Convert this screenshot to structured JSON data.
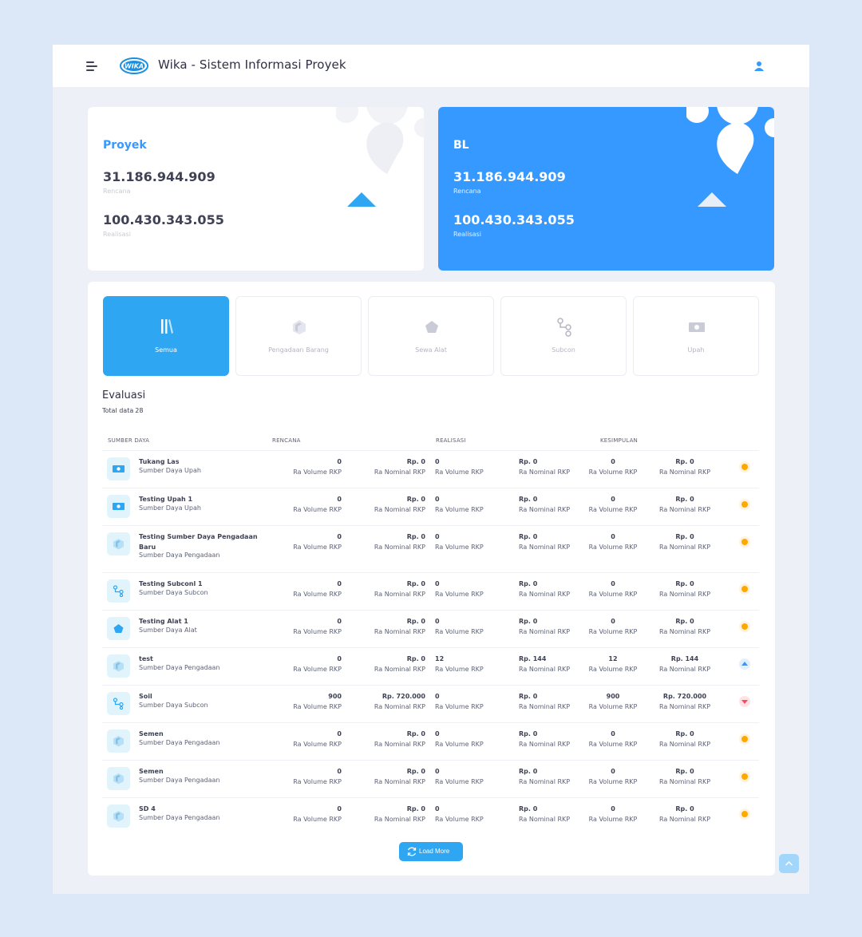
{
  "header": {
    "title": "Wika - Sistem Informasi Proyek",
    "logo_text": "WIKA"
  },
  "cards": {
    "proyek": {
      "title": "Proyek",
      "rencana_value": "31.186.944.909",
      "rencana_label": "Rencana",
      "realisasi_value": "100.430.343.055",
      "realisasi_label": "Realisasi"
    },
    "bl": {
      "title": "BL",
      "rencana_value": "31.186.944.909",
      "rencana_label": "Rencana",
      "realisasi_value": "100.430.343.055",
      "realisasi_label": "Realisasi"
    }
  },
  "tabs": [
    {
      "label": "Semua",
      "icon": "library-icon",
      "active": true
    },
    {
      "label": "Pengadaan Barang",
      "icon": "box-icon",
      "active": false
    },
    {
      "label": "Sewa Alat",
      "icon": "pentagon-icon",
      "active": false
    },
    {
      "label": "Subcon",
      "icon": "subcon-icon",
      "active": false
    },
    {
      "label": "Upah",
      "icon": "money-icon",
      "active": false
    }
  ],
  "evaluasi": {
    "title": "Evaluasi",
    "total_label": "Total data",
    "total": "28"
  },
  "table": {
    "headers": [
      "SUMBER DAYA",
      "RENCANA",
      "REALISASI",
      "KESIMPULAN"
    ],
    "volume_label": "Ra Volume RKP",
    "nominal_label": "Ra Nominal RKP",
    "rows": [
      {
        "name": "Tukang Las",
        "type": "Sumber Daya Upah",
        "icon": "money-icon",
        "rencana_vol": "0",
        "rencana_nom": "Rp. 0",
        "realisasi_vol": "0",
        "realisasi_nom": "Rp. 0",
        "kesimpulan_vol": "0",
        "kesimpulan_nom": "Rp. 0",
        "status": "orange"
      },
      {
        "name": "Testing Upah 1",
        "type": "Sumber Daya Upah",
        "icon": "money-icon",
        "rencana_vol": "0",
        "rencana_nom": "Rp. 0",
        "realisasi_vol": "0",
        "realisasi_nom": "Rp. 0",
        "kesimpulan_vol": "0",
        "kesimpulan_nom": "Rp. 0",
        "status": "orange"
      },
      {
        "name": "Testing Sumber Daya Pengadaan Baru",
        "type": "Sumber Daya Pengadaan",
        "icon": "box-icon",
        "rencana_vol": "0",
        "rencana_nom": "Rp. 0",
        "realisasi_vol": "0",
        "realisasi_nom": "Rp. 0",
        "kesimpulan_vol": "0",
        "kesimpulan_nom": "Rp. 0",
        "status": "orange"
      },
      {
        "name": "Testing Subconl 1",
        "type": "Sumber Daya Subcon",
        "icon": "subcon-icon",
        "rencana_vol": "0",
        "rencana_nom": "Rp. 0",
        "realisasi_vol": "0",
        "realisasi_nom": "Rp. 0",
        "kesimpulan_vol": "0",
        "kesimpulan_nom": "Rp. 0",
        "status": "orange"
      },
      {
        "name": "Testing Alat 1",
        "type": "Sumber Daya Alat",
        "icon": "pentagon-icon",
        "rencana_vol": "0",
        "rencana_nom": "Rp. 0",
        "realisasi_vol": "0",
        "realisasi_nom": "Rp. 0",
        "kesimpulan_vol": "0",
        "kesimpulan_nom": "Rp. 0",
        "status": "orange"
      },
      {
        "name": "test",
        "type": "Sumber Daya Pengadaan",
        "icon": "box-icon",
        "rencana_vol": "0",
        "rencana_nom": "Rp. 0",
        "realisasi_vol": "12",
        "realisasi_nom": "Rp. 144",
        "kesimpulan_vol": "12",
        "kesimpulan_nom": "Rp. 144",
        "status": "up"
      },
      {
        "name": "Soil",
        "type": "Sumber Daya Subcon",
        "icon": "subcon-icon",
        "rencana_vol": "900",
        "rencana_nom": "Rp. 720.000",
        "realisasi_vol": "0",
        "realisasi_nom": "Rp. 0",
        "kesimpulan_vol": "900",
        "kesimpulan_nom": "Rp. 720.000",
        "status": "down"
      },
      {
        "name": "Semen",
        "type": "Sumber Daya Pengadaan",
        "icon": "box-icon",
        "rencana_vol": "0",
        "rencana_nom": "Rp. 0",
        "realisasi_vol": "0",
        "realisasi_nom": "Rp. 0",
        "kesimpulan_vol": "0",
        "kesimpulan_nom": "Rp. 0",
        "status": "orange"
      },
      {
        "name": "Semen",
        "type": "Sumber Daya Pengadaan",
        "icon": "box-icon",
        "rencana_vol": "0",
        "rencana_nom": "Rp. 0",
        "realisasi_vol": "0",
        "realisasi_nom": "Rp. 0",
        "kesimpulan_vol": "0",
        "kesimpulan_nom": "Rp. 0",
        "status": "orange"
      },
      {
        "name": "SD 4",
        "type": "Sumber Daya Pengadaan",
        "icon": "box-icon",
        "rencana_vol": "0",
        "rencana_nom": "Rp. 0",
        "realisasi_vol": "0",
        "realisasi_nom": "Rp. 0",
        "kesimpulan_vol": "0",
        "kesimpulan_nom": "Rp. 0",
        "status": "orange"
      }
    ]
  },
  "load_more_label": "Load More",
  "colors": {
    "primary": "#3699ff",
    "tab_active": "#2ea6f2",
    "warning": "#ffa800",
    "danger": "#f64e60"
  }
}
